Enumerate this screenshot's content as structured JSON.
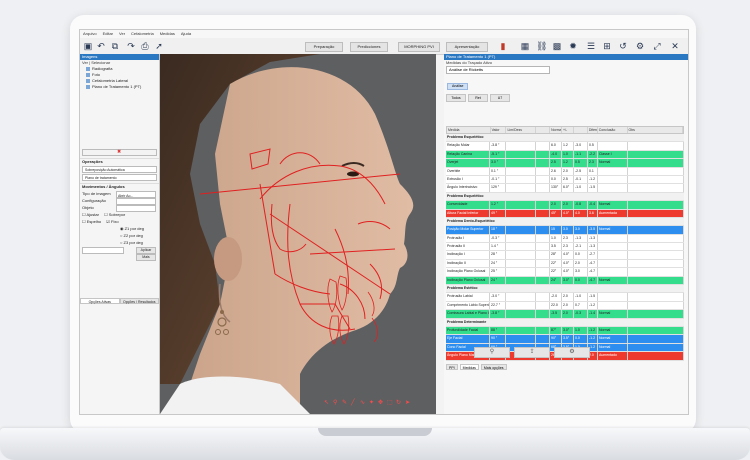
{
  "menu": [
    "Arquivo",
    "Editar",
    "Ver",
    "Cefalometria",
    "Medidas",
    "Ajuda"
  ],
  "toolbar": {
    "buttons": [
      "Preparação",
      "Predicciones",
      "MORPHING PVI",
      "Apresentação"
    ]
  },
  "left": {
    "title": "Imagens",
    "subtitle": "Ver | Selecionar",
    "tree": [
      "Radiografia",
      "Foto",
      "Cefalometria Lateral",
      "Plano de Tratamento 1 (PT)"
    ],
    "section1": "Operações",
    "select1": "Sobreposição Automática",
    "select2": "Plano de tratamento",
    "section2": "Movimentos / Ângulos",
    "field_labels": [
      "Tipo de imagem",
      "Configuração",
      "Objeto"
    ],
    "field_values": [
      "Abrir Ao...",
      "",
      ""
    ],
    "checks": [
      "Ajustar",
      "Sobrepor",
      "Espelho",
      "Fixo"
    ],
    "radios": [
      "Z1 por deg",
      "Z2 por deg",
      "Z3 por deg"
    ],
    "button_aplicar": "Aplicar",
    "button_mais": "Mais",
    "tabs": [
      "Opções Ativas",
      "Opções / Resultados"
    ]
  },
  "right": {
    "title": "Plano de Tratamento 1 (PT)",
    "subtitle": "Medidas do Traçado Ativo",
    "select": "Análise de Ricketts",
    "chip": "Análise",
    "tabs": [
      "Todos",
      "Ret",
      "U7"
    ],
    "columns": [
      "Medida",
      "Valor",
      "Lim/Desv",
      "",
      "Norma",
      "+/-",
      "",
      "Diferença",
      "Conclusão",
      "Obs"
    ],
    "rows": [
      {
        "type": "group",
        "label": "Problema Esquelético"
      },
      {
        "type": "blank",
        "cells": [
          "Relação Molar",
          "-3.8 °",
          "",
          "",
          "6.0",
          "1.2",
          "-3.0",
          "0.5",
          ""
        ]
      },
      {
        "type": "green",
        "cells": [
          "Relação Canina",
          "-5.1 °",
          "",
          "",
          "-4.0",
          "1.0",
          "-1.1",
          "-2.2",
          "Classe I"
        ]
      },
      {
        "type": "green",
        "cells": [
          "Overjet",
          "3.0 °",
          "",
          "",
          "2.5",
          "1.2",
          "0.5",
          "2.3",
          "Normal"
        ]
      },
      {
        "type": "blank",
        "cells": [
          "Overbite",
          "0.1 °",
          "",
          "",
          "2.6",
          "2.0",
          "-2.5",
          "0.1",
          ""
        ]
      },
      {
        "type": "blank",
        "cells": [
          "Extrusão I",
          "-0.1 °",
          "",
          "",
          "0.0",
          "2.5",
          "-0.1",
          "-1.2",
          ""
        ]
      },
      {
        "type": "blank",
        "cells": [
          "Ângulo Interincisivo",
          "129 °",
          "",
          "",
          "130°",
          "6.0°",
          "-1.0",
          "-1.5",
          ""
        ]
      },
      {
        "type": "group",
        "label": "Problema Esquelético"
      },
      {
        "type": "green",
        "cells": [
          "Convexidade",
          "1.2 °",
          "",
          "",
          "2.0",
          "2.0",
          "-0.8",
          "-0.4",
          "Normal"
        ]
      },
      {
        "type": "red",
        "cells": [
          "Altura Facial Inferior",
          "49 °",
          "",
          "",
          "45°",
          "4.0°",
          "4.0",
          "3.6",
          "Aumentada"
        ]
      },
      {
        "type": "group",
        "label": "Problema Dento-Esquelético"
      },
      {
        "type": "blue",
        "cells": [
          "Posição Molar Superior",
          "18 °",
          "",
          "",
          "15",
          "3.0",
          "3.0",
          "-3.5",
          "Normal"
        ]
      },
      {
        "type": "blank",
        "cells": [
          "Protrusão I",
          "-0.3 °",
          "",
          "",
          "1.0",
          "2.3",
          "-1.3",
          "-1.3",
          ""
        ]
      },
      {
        "type": "blank",
        "cells": [
          "Protrusão II",
          "1.4 °",
          "",
          "",
          "3.5",
          "2.3",
          "-2.1",
          "-1.3",
          ""
        ]
      },
      {
        "type": "blank",
        "cells": [
          "Inclinação I",
          "28 °",
          "",
          "",
          "28°",
          "4.0°",
          "0.0",
          "-2.7",
          ""
        ]
      },
      {
        "type": "blank",
        "cells": [
          "Inclinação II",
          "24 °",
          "",
          "",
          "22°",
          "4.0°",
          "2.0",
          "-4.7",
          ""
        ]
      },
      {
        "type": "blank",
        "cells": [
          "Inclinação Plano Oclusal",
          "25 °",
          "",
          "",
          "22°",
          "4.0°",
          "3.0",
          "-4.7",
          ""
        ]
      },
      {
        "type": "green",
        "cells": [
          "Inclinação Plano Oclusal",
          "24 °",
          "",
          "",
          "24°",
          "3.0°",
          "0.0",
          "-4.7",
          "Normal"
        ]
      },
      {
        "type": "group",
        "label": "Problema Estético"
      },
      {
        "type": "blank",
        "cells": [
          "Protrusão Labial",
          "-3.0 °",
          "",
          "",
          "-2.0",
          "2.0",
          "-1.0",
          "-1.5",
          ""
        ]
      },
      {
        "type": "blank",
        "cells": [
          "Comprimento Lábio Superior",
          "22.7 °",
          "",
          "",
          "22.0",
          "2.0",
          "0.7",
          "-1.2",
          ""
        ]
      },
      {
        "type": "green",
        "cells": [
          "Comissura Labial e Plano Ocl.",
          "-3.8 °",
          "",
          "",
          "-3.5",
          "2.0",
          "-0.3",
          "-1.4",
          "Normal"
        ]
      },
      {
        "type": "group",
        "label": "Problema Determinante"
      },
      {
        "type": "green",
        "cells": [
          "Profundidade Facial",
          "88 °",
          "",
          "",
          "87°",
          "3.0°",
          "1.0",
          "-1.2",
          "Normal"
        ]
      },
      {
        "type": "blue",
        "cells": [
          "Eje Facial",
          "90 °",
          "",
          "",
          "90°",
          "3.5°",
          "0.0",
          "-1.2",
          "Normal"
        ]
      },
      {
        "type": "blue",
        "cells": [
          "Cono Facial",
          "69 °",
          "",
          "",
          "68°",
          "3.5°",
          "1.0",
          "-1.2",
          "Normal"
        ]
      },
      {
        "type": "red",
        "cells": [
          "Ângulo Plano Mandibular",
          "31 °",
          "",
          "",
          "26°",
          "4.5°",
          "5.0",
          "2.0",
          "Aumentado"
        ]
      }
    ],
    "foot_tabs": [
      "PPI",
      "Medidas",
      "Mais opções"
    ]
  }
}
